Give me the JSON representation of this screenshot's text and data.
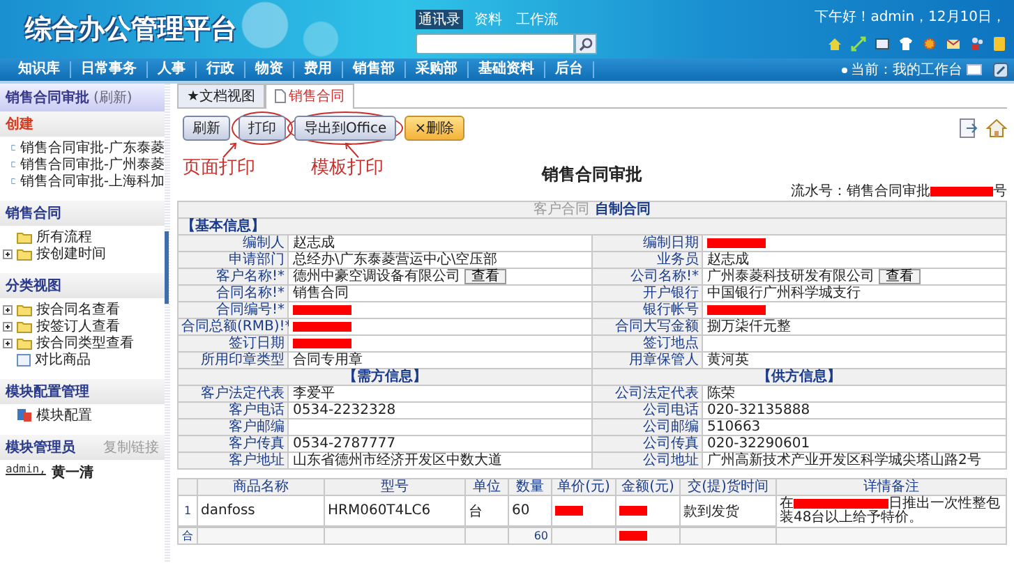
{
  "header": {
    "title": "综合办公管理平台",
    "top_links": [
      {
        "label": "通讯录",
        "selected": true
      },
      {
        "label": "资料",
        "selected": false
      },
      {
        "label": "工作流",
        "selected": false
      }
    ],
    "greeting": "下午好！admin，12月10日，"
  },
  "nav": {
    "items": [
      "知识库",
      "日常事务",
      "人事",
      "行政",
      "物资",
      "费用",
      "销售部",
      "采购部",
      "基础资料",
      "后台"
    ],
    "current": "当前：我的工作台"
  },
  "sidebar": {
    "title": "销售合同审批",
    "refresh": "(刷新)",
    "sections": [
      {
        "title": "创建",
        "color": "#d23b1e",
        "items": [
          {
            "label": "销售合同审批-广东泰菱",
            "kind": "doc",
            "expandable": false
          },
          {
            "label": "销售合同审批-广州泰菱",
            "kind": "doc",
            "expandable": false
          },
          {
            "label": "销售合同审批-上海科加",
            "kind": "doc",
            "expandable": false
          }
        ]
      },
      {
        "title": "销售合同",
        "color": "#2a3a8c",
        "items": [
          {
            "label": "所有流程",
            "kind": "folder",
            "expandable": false
          },
          {
            "label": "按创建时间",
            "kind": "folder",
            "expandable": true
          }
        ]
      },
      {
        "title": "分类视图",
        "color": "#2a3a8c",
        "items": [
          {
            "label": "按合同名查看",
            "kind": "folder",
            "expandable": true
          },
          {
            "label": "按签订人查看",
            "kind": "folder",
            "expandable": true
          },
          {
            "label": "按合同类型查看",
            "kind": "folder",
            "expandable": true
          },
          {
            "label": "对比商品",
            "kind": "page",
            "expandable": false
          }
        ]
      },
      {
        "title": "模块配置管理",
        "color": "#2a3a8c",
        "items": [
          {
            "label": "模块配置",
            "kind": "config",
            "expandable": false
          }
        ]
      }
    ],
    "admins": {
      "title": "模块管理员",
      "link": "复制链接",
      "user": "admin,",
      "name": "黄一清"
    }
  },
  "tabs": [
    {
      "label": "★文档视图",
      "selected": false
    },
    {
      "label": "销售合同",
      "selected": true
    }
  ],
  "toolbar": [
    {
      "label": "刷新",
      "kind": "plain",
      "circled": false
    },
    {
      "label": "打印",
      "kind": "plain",
      "circled": true,
      "note": "页面打印"
    },
    {
      "label": "导出到Office",
      "kind": "plain",
      "circled": true,
      "note": "模板打印"
    },
    {
      "label": "×删除",
      "kind": "warning",
      "circled": false
    }
  ],
  "form": {
    "title": "销售合同审批",
    "serial_prefix": "流水号：销售合同审批",
    "serial_suffix": "号",
    "contract_types": [
      {
        "label": "客户合同",
        "selected": false
      },
      {
        "label": "自制合同",
        "selected": true
      }
    ],
    "basic_title": "【基本信息】",
    "basic_rows": [
      {
        "left": {
          "label": "编制人",
          "value": "赵志成"
        },
        "right": {
          "label": "编制日期",
          "redacted": true
        }
      },
      {
        "left": {
          "label": "申请部门",
          "value": "总经办\\广东泰菱营运中心\\空压部"
        },
        "right": {
          "label": "业务员",
          "value": "赵志成"
        }
      },
      {
        "left": {
          "label": "客户名称!*",
          "value": "德州中豪空调设备有限公司",
          "button": "查看"
        },
        "right": {
          "label": "公司名称!*",
          "value": "广州泰菱科技研发有限公司",
          "button": "查看"
        }
      },
      {
        "left": {
          "label": "合同名称!*",
          "value": "销售合同"
        },
        "right": {
          "label": "开户银行",
          "value": "中国银行广州科学城支行"
        }
      },
      {
        "left": {
          "label": "合同编号!*",
          "redacted": true
        },
        "right": {
          "label": "银行帐号",
          "redacted": true
        }
      },
      {
        "left": {
          "label": "合同总额(RMB)!*",
          "redacted": true
        },
        "right": {
          "label": "合同大写金额",
          "value": "捌万柒仟元整"
        }
      },
      {
        "left": {
          "label": "签订日期",
          "redacted": true
        },
        "right": {
          "label": "签订地点"
        }
      },
      {
        "left": {
          "label": "所用印章类型",
          "value": "合同专用章"
        },
        "right": {
          "label": "用章保管人",
          "value": "黄河英"
        }
      }
    ],
    "party_titles": [
      "【需方信息】",
      "【供方信息】"
    ],
    "party_rows": [
      {
        "left": {
          "label": "客户法定代表",
          "value": "李爱平"
        },
        "right": {
          "label": "公司法定代表",
          "value": "陈荣"
        }
      },
      {
        "left": {
          "label": "客户电话",
          "value": "0534-2232328"
        },
        "right": {
          "label": "公司电话",
          "value": "020-32135888"
        }
      },
      {
        "left": {
          "label": "客户邮编"
        },
        "right": {
          "label": "公司邮编",
          "value": "510663"
        }
      },
      {
        "left": {
          "label": "客户传真",
          "value": "0534-2787777"
        },
        "right": {
          "label": "公司传真",
          "value": "020-32290601"
        }
      },
      {
        "left": {
          "label": "客户地址",
          "value": "山东省德州市经济开发区中数大道"
        },
        "right": {
          "label": "公司地址",
          "value": "广州高新技术产业开发区科学城尖塔山路2号"
        }
      }
    ]
  },
  "products": {
    "columns": [
      "商品名称",
      "型号",
      "单位",
      "数量",
      "单价(元)",
      "金额(元)",
      "交(提)货时间",
      "详情备注"
    ],
    "rows": [
      {
        "index": "1",
        "cells": [
          {
            "kind": "text",
            "text": "danfoss"
          },
          {
            "kind": "text",
            "text": "HRM060T4LC6"
          },
          {
            "kind": "text",
            "text": "台"
          },
          {
            "kind": "text",
            "text": "60"
          },
          {
            "kind": "redacted"
          },
          {
            "kind": "redacted"
          },
          {
            "kind": "text",
            "text": "款到发货"
          },
          {
            "kind": "note",
            "before": "在",
            "after": "日推出一次性整包装48台以上给予特价。"
          }
        ]
      }
    ],
    "total": {
      "label": "合",
      "cells": [
        {
          "kind": "empty"
        },
        {
          "kind": "empty"
        },
        {
          "kind": "empty"
        },
        {
          "kind": "number",
          "text": "60"
        },
        {
          "kind": "empty"
        },
        {
          "kind": "redacted"
        },
        {
          "kind": "empty"
        },
        {
          "kind": "empty"
        }
      ]
    }
  }
}
